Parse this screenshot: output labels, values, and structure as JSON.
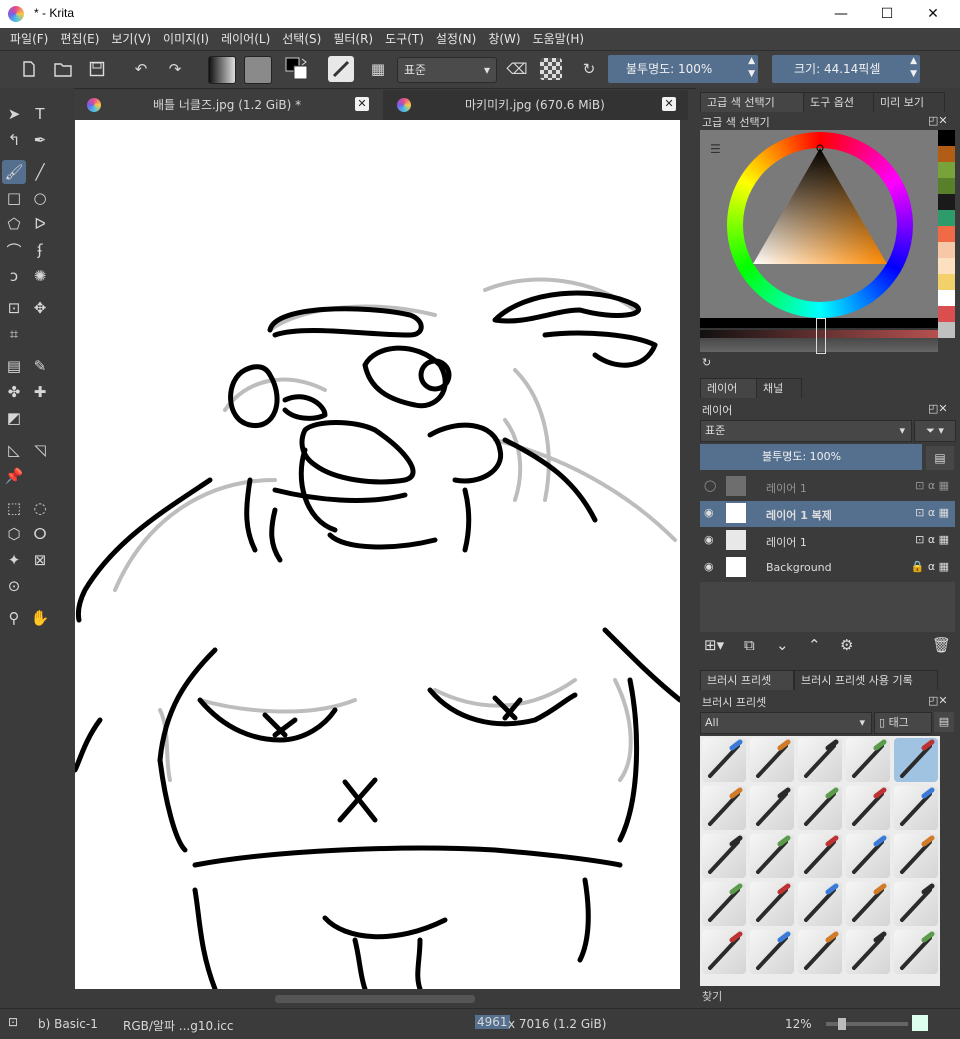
{
  "window": {
    "title": "* - Krita",
    "minimize": "—",
    "maximize": "☐",
    "close": "✕"
  },
  "menu": [
    "파일(F)",
    "편집(E)",
    "보기(V)",
    "이미지(I)",
    "레이어(L)",
    "선택(S)",
    "필터(R)",
    "도구(T)",
    "설정(N)",
    "창(W)",
    "도움말(H)"
  ],
  "toolbar": {
    "blend_mode": "표준",
    "opacity_label": "불투명도:  100%",
    "size_label": "크기:  44.14픽셀"
  },
  "doc_tabs": [
    {
      "label": "배틀 너클즈.jpg (1.2 GiB) *"
    },
    {
      "label": "마키미키.jpg (670.6 MiB)"
    }
  ],
  "dock_tabs_top": [
    "고급 색 선택기",
    "도구 옵션",
    "미리 보기"
  ],
  "color_selector": {
    "title": "고급 색 선택기",
    "swatches": [
      "#000000",
      "#b25d16",
      "#78a33a",
      "#58802a",
      "#1a1a1a",
      "#2e9b6a",
      "#f06a45",
      "#f7c8a8",
      "#fde0c0",
      "#f2d16a",
      "#ffffff",
      "#d94e4e",
      "#c0c0c0"
    ]
  },
  "layers_panel": {
    "tabs": [
      "레이어",
      "채널"
    ],
    "title": "레이어",
    "blend_mode": "표준",
    "opacity": "불투명도:  100%",
    "layers": [
      {
        "name": "레이어 1",
        "visible": false,
        "selected": false
      },
      {
        "name": "레이어 1 복제",
        "visible": true,
        "selected": true
      },
      {
        "name": "레이어 1",
        "visible": true,
        "selected": false
      },
      {
        "name": "Background",
        "visible": true,
        "selected": false
      }
    ]
  },
  "brush_panel": {
    "tabs": [
      "브러시 프리셋",
      "브러시 프리셋 사용 기록"
    ],
    "title": "브러시 프리셋",
    "filter": "All",
    "tag": "태그",
    "search_placeholder": "찾기"
  },
  "status": {
    "brush": "b) Basic-1",
    "color_profile": "RGB/알파 ...g10.icc",
    "dimensions_w": "4961",
    "dimensions_rest": "x 7016 (1.2 GiB)",
    "zoom": "12%"
  },
  "colors": {
    "accent": "#55708f",
    "panel": "#3b3b3b"
  }
}
